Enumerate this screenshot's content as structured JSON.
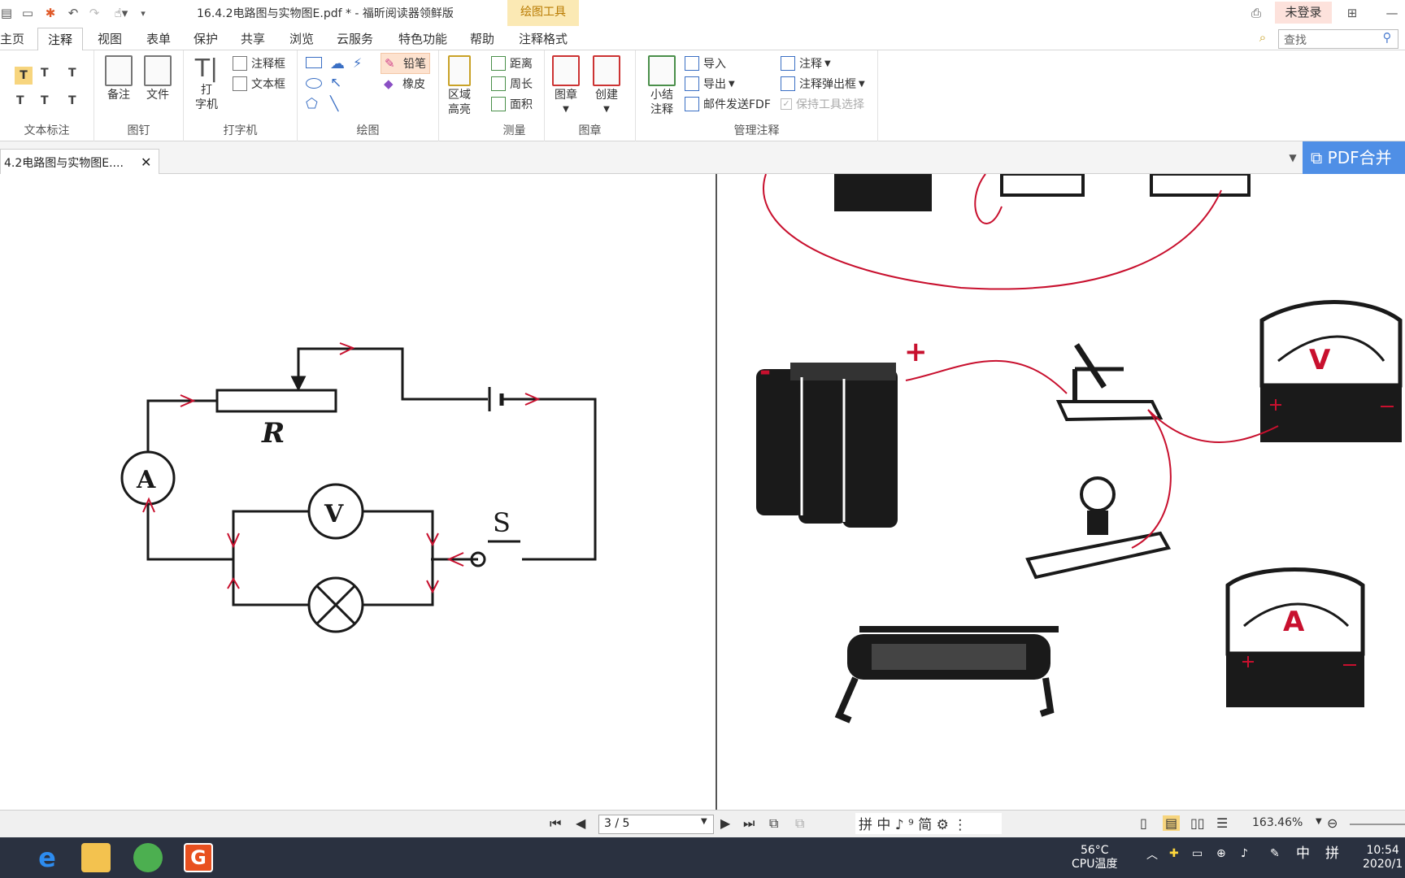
{
  "window": {
    "title": "16.4.2电路图与实物图E.pdf * - 福昕阅读器领鲜版",
    "context_tab": "绘图工具",
    "login": "未登录"
  },
  "menu": {
    "tabs": [
      "主页",
      "注释",
      "视图",
      "表单",
      "保护",
      "共享",
      "浏览",
      "云服务",
      "特色功能",
      "帮助",
      "注释格式"
    ],
    "active": "注释",
    "search_placeholder": "查找"
  },
  "ribbon": {
    "groups": {
      "text_markup": "文本标注",
      "pin": "图钉",
      "typewriter": "打字机",
      "drawing": "绘图",
      "measure": "测量",
      "stamp": "图章",
      "manage": "管理注释"
    },
    "items": {
      "note": "备注",
      "file": "文件",
      "typewriter_line1": "打",
      "typewriter_line2": "字机",
      "callout": "注释框",
      "textbox": "文本框",
      "pencil": "铅笔",
      "eraser": "橡皮",
      "area_highlight_line1": "区域",
      "area_highlight_line2": "高亮",
      "distance": "距离",
      "perimeter": "周长",
      "area": "面积",
      "stamp": "图章",
      "create": "创建",
      "summary_line1": "小结",
      "summary_line2": "注释",
      "import": "导入",
      "export": "导出",
      "email_fdf": "邮件发送FDF",
      "comments": "注释",
      "comment_popup": "注释弹出框",
      "keep_tool": "保持工具选择"
    }
  },
  "document_tab": {
    "label": "4.2电路图与实物图E....",
    "merge_button": "PDF合并"
  },
  "circuit": {
    "resistor_label": "R",
    "ammeter_label": "A",
    "voltmeter_label": "V",
    "switch_label": "S"
  },
  "real_objects": {
    "battery_minus": "-",
    "battery_plus": "+",
    "voltmeter_letter": "V",
    "ammeter_letter": "A"
  },
  "status": {
    "page": "3 / 5",
    "zoom": "163.46%"
  },
  "taskbar": {
    "temperature": "56°C",
    "temp_label": "CPU温度",
    "ime1": "中",
    "ime2": "拼",
    "clock_time": "10:54",
    "clock_date": "2020/1"
  },
  "colors": {
    "context_tab_bg": "#fbe9b4",
    "login_bg": "#fde2dc",
    "merge_bg": "#4f8fe6",
    "annotation_red": "#c8102e",
    "taskbar_bg": "#2a3140"
  }
}
